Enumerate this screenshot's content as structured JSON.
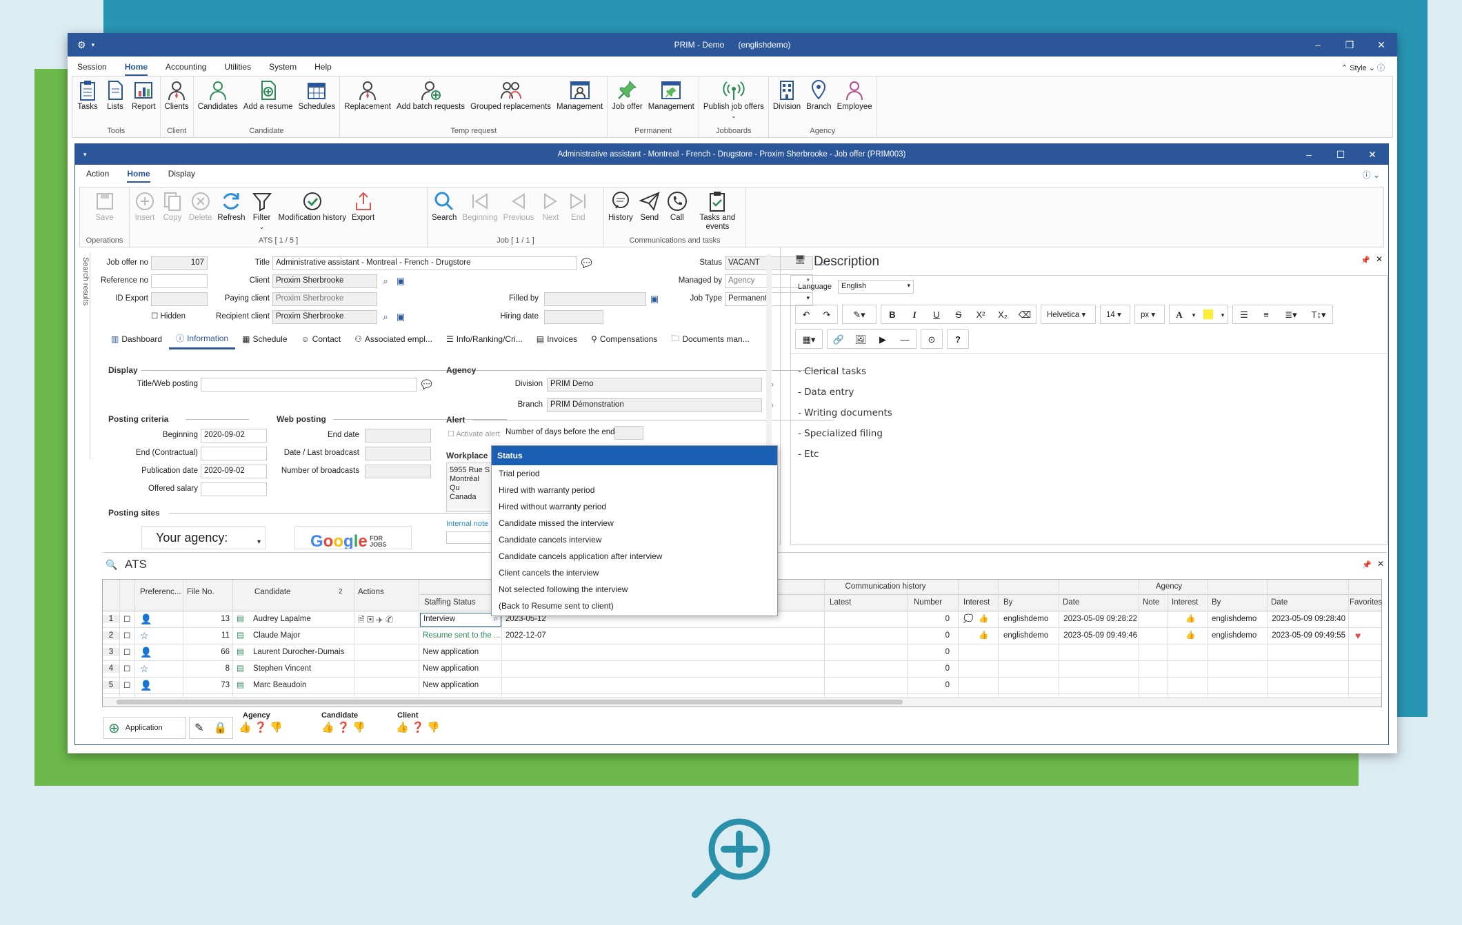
{
  "app": {
    "title": "PRIM - Demo",
    "user": "(englishdemo)"
  },
  "menu": [
    "Session",
    "Home",
    "Accounting",
    "Utilities",
    "System",
    "Help"
  ],
  "style_label": "Style",
  "ribbon": {
    "groups": [
      {
        "label": "Tools",
        "buttons": [
          "Tasks",
          "Lists",
          "Report"
        ]
      },
      {
        "label": "Client",
        "buttons": [
          "Clients"
        ]
      },
      {
        "label": "Candidate",
        "buttons": [
          "Candidates",
          "Add a resume",
          "Schedules"
        ]
      },
      {
        "label": "Temp request",
        "buttons": [
          "Replacement",
          "Add batch requests",
          "Grouped replacements",
          "Management"
        ]
      },
      {
        "label": "Permanent",
        "buttons": [
          "Job offer",
          "Management"
        ]
      },
      {
        "label": "Jobboards",
        "buttons": [
          "Publish job offers"
        ]
      },
      {
        "label": "Agency",
        "buttons": [
          "Division",
          "Branch",
          "Employee"
        ]
      }
    ]
  },
  "child": {
    "title": "Administrative assistant - Montreal - French - Drugstore - Proxim Sherbrooke - Job offer (PRIM003)",
    "menu": [
      "Action",
      "Home",
      "Display"
    ],
    "ribbon": {
      "operations": {
        "label": "Operations",
        "buttons": [
          "Save"
        ]
      },
      "ats": {
        "label": "ATS [ 1 / 5 ]",
        "buttons": [
          "Insert",
          "Copy",
          "Delete",
          "Refresh",
          "Filter",
          "Modification history",
          "Export"
        ]
      },
      "job": {
        "label": "Job [ 1 / 1 ]",
        "buttons": [
          "Search",
          "Beginning",
          "Previous",
          "Next",
          "End"
        ]
      },
      "comm": {
        "label": "Communications and tasks",
        "buttons": [
          "History",
          "Send",
          "Call",
          "Tasks and events"
        ]
      }
    },
    "side_tab": "Search results",
    "form": {
      "job_offer_no_label": "Job offer no",
      "job_offer_no": "107",
      "reference_no_label": "Reference no",
      "id_export_label": "ID Export",
      "hidden_label": "Hidden",
      "title_label": "Title",
      "title": "Administrative assistant - Montreal - French - Drugstore",
      "client_label": "Client",
      "client": "Proxim Sherbrooke",
      "paying_client_label": "Paying client",
      "paying_client": "Proxim Sherbrooke",
      "recipient_client_label": "Recipient client",
      "recipient_client": "Proxim Sherbrooke",
      "filled_by_label": "Filled by",
      "hiring_date_label": "Hiring date",
      "status_label": "Status",
      "status": "VACANT",
      "managed_by_label": "Managed by",
      "managed_by": "Agency",
      "job_type_label": "Job Type",
      "job_type": "Permanent"
    },
    "tabs": [
      "Dashboard",
      "Information",
      "Schedule",
      "Contact",
      "Associated empl...",
      "Info/Ranking/Cri...",
      "Invoices",
      "Compensations",
      "Documents man..."
    ],
    "info": {
      "display_label": "Display",
      "title_web_label": "Title/Web posting",
      "posting_criteria_label": "Posting criteria",
      "beginning_label": "Beginning",
      "beginning": "2020-09-02",
      "end_label": "End (Contractual)",
      "publication_label": "Publication date",
      "publication": "2020-09-02",
      "salary_label": "Offered salary",
      "web_posting_label": "Web posting",
      "end_date_label": "End date",
      "last_broadcast_label": "Date / Last broadcast",
      "broadcasts_label": "Number of broadcasts",
      "posting_sites_label": "Posting sites",
      "your_agency": "Your agency:",
      "google_text": "Google",
      "google_sub": "FOR JOBS",
      "agency_label": "Agency",
      "division_label": "Division",
      "division": "PRIM Demo",
      "branch_label": "Branch",
      "branch": "PRIM Démonstration",
      "alert_label": "Alert",
      "activate_alert": "Activate alert",
      "days_before_end": "Number of days before the end",
      "workplace_label": "Workplace",
      "workplace_lines": [
        "5955 Rue S",
        "Montréal Qu",
        "Canada"
      ],
      "internal_note_label": "Internal note"
    },
    "description": {
      "title": "Description",
      "language_label": "Language",
      "language": "English",
      "font": "Helvetica",
      "size": "14",
      "unit": "px",
      "lines": [
        "- Clerical tasks",
        "- Data entry",
        "- Writing documents",
        "- Specialized filing",
        "- Etc"
      ]
    },
    "status_dropdown": {
      "header": "Status",
      "options": [
        "Trial period",
        "Hired with warranty period",
        "Hired without warranty period",
        "Candidate missed the interview",
        "Candidate cancels interview",
        "Candidate cancels application after interview",
        "Client cancels the interview",
        "Not selected following the interview",
        "(Back to Resume sent to client)"
      ]
    },
    "ats": {
      "title": "ATS",
      "group_headers": {
        "communication": "Communication history",
        "agency": "Agency"
      },
      "columns": [
        "Preferenc...",
        "File No.",
        "Candidate",
        "Actions",
        "Staffing Status",
        "Latest",
        "Number",
        "Interest",
        "By",
        "Date",
        "Note",
        "Interest",
        "By",
        "Date",
        "Favorites"
      ],
      "sort_indicator": "2",
      "rows": [
        {
          "n": "1",
          "file": "13",
          "name": "Audrey Lapalme",
          "status": "Interview",
          "date": "2023-05-12",
          "number": "0",
          "by1": "englishdemo",
          "date1": "2023-05-09 09:28:22",
          "by2": "englishdemo",
          "date2": "2023-05-09 09:28:40"
        },
        {
          "n": "2",
          "file": "11",
          "name": "Claude Major",
          "status": "Resume sent to the ...",
          "date": "2022-12-07",
          "number": "0",
          "by1": "englishdemo",
          "date1": "2023-05-09 09:49:46",
          "by2": "englishdemo",
          "date2": "2023-05-09 09:49:55"
        },
        {
          "n": "3",
          "file": "66",
          "name": "Laurent Durocher-Dumais",
          "status": "New application",
          "date": "",
          "number": "0",
          "by1": "",
          "date1": "",
          "by2": "",
          "date2": ""
        },
        {
          "n": "4",
          "file": "8",
          "name": "Stephen Vincent",
          "status": "New application",
          "date": "",
          "number": "0",
          "by1": "",
          "date1": "",
          "by2": "",
          "date2": ""
        },
        {
          "n": "5",
          "file": "73",
          "name": "Marc Beaudoin",
          "status": "New application",
          "date": "",
          "number": "0",
          "by1": "",
          "date1": "",
          "by2": "",
          "date2": ""
        }
      ],
      "bottom": {
        "application": "Application",
        "agency": "Agency",
        "candidate": "Candidate",
        "client": "Client"
      }
    }
  },
  "colors": {
    "blue": "#2b579a",
    "teal": "#2895b3",
    "green": "#6cb84a",
    "icon": "#2e8b57"
  }
}
